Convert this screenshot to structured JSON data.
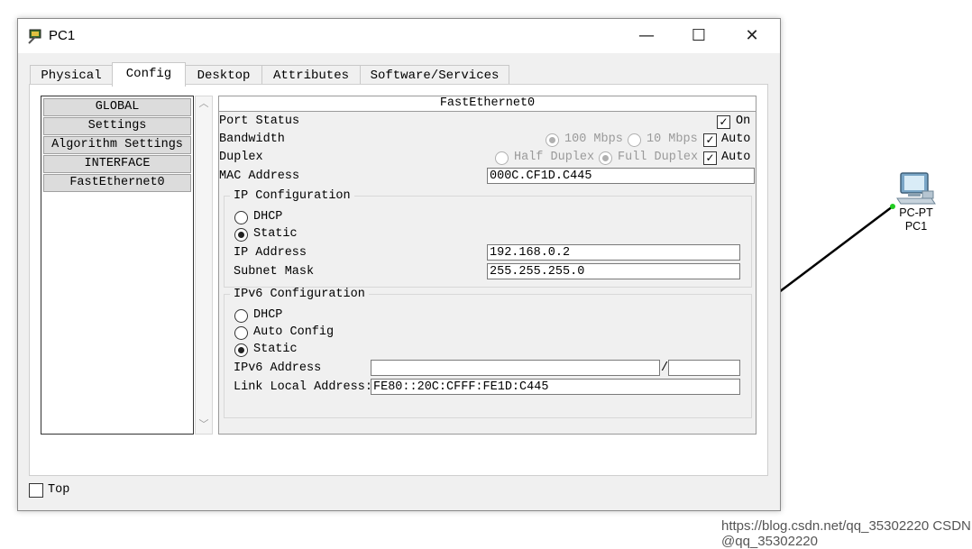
{
  "window": {
    "title": "PC1",
    "minimize": "—",
    "maximize": "☐",
    "close": "✕"
  },
  "tabs": [
    {
      "label": "Physical"
    },
    {
      "label": "Config"
    },
    {
      "label": "Desktop"
    },
    {
      "label": "Attributes"
    },
    {
      "label": "Software/Services"
    }
  ],
  "active_tab": "Config",
  "left_list": [
    {
      "label": "GLOBAL"
    },
    {
      "label": "Settings"
    },
    {
      "label": "Algorithm Settings"
    },
    {
      "label": "INTERFACE"
    },
    {
      "label": "FastEthernet0"
    }
  ],
  "panel": {
    "header": "FastEthernet0",
    "port_status": {
      "label": "Port Status",
      "on_label": "On",
      "on_checked": true
    },
    "bandwidth": {
      "label": "Bandwidth",
      "opt1": "100 Mbps",
      "opt2": "10 Mbps",
      "auto_label": "Auto",
      "auto_checked": true
    },
    "duplex": {
      "label": "Duplex",
      "opt1": "Half Duplex",
      "opt2": "Full Duplex",
      "auto_label": "Auto",
      "auto_checked": true
    },
    "mac": {
      "label": "MAC Address",
      "value": "000C.CF1D.C445"
    },
    "ip_config": {
      "title": "IP Configuration",
      "dhcp": "DHCP",
      "static": "Static",
      "selected": "Static",
      "ip_label": "IP Address",
      "ip_value": "192.168.0.2",
      "mask_label": "Subnet Mask",
      "mask_value": "255.255.255.0"
    },
    "ipv6_config": {
      "title": "IPv6 Configuration",
      "dhcp": "DHCP",
      "auto": "Auto Config",
      "static": "Static",
      "selected": "Static",
      "addr_label": "IPv6 Address",
      "addr_value": "",
      "separator": "/",
      "prefix_value": "",
      "link_local_label": "Link Local Address:",
      "link_local_value": "FE80::20C:CFFF:FE1D:C445"
    }
  },
  "bottom": {
    "top_label": "Top",
    "top_checked": false
  },
  "workspace": {
    "device_type": "PC-PT",
    "device_name": "PC1",
    "link_color": "#000000",
    "port_color": "#22cc22"
  },
  "watermark": "https://blog.csdn.net/qq_35302220  CSDN @qq_35302220"
}
